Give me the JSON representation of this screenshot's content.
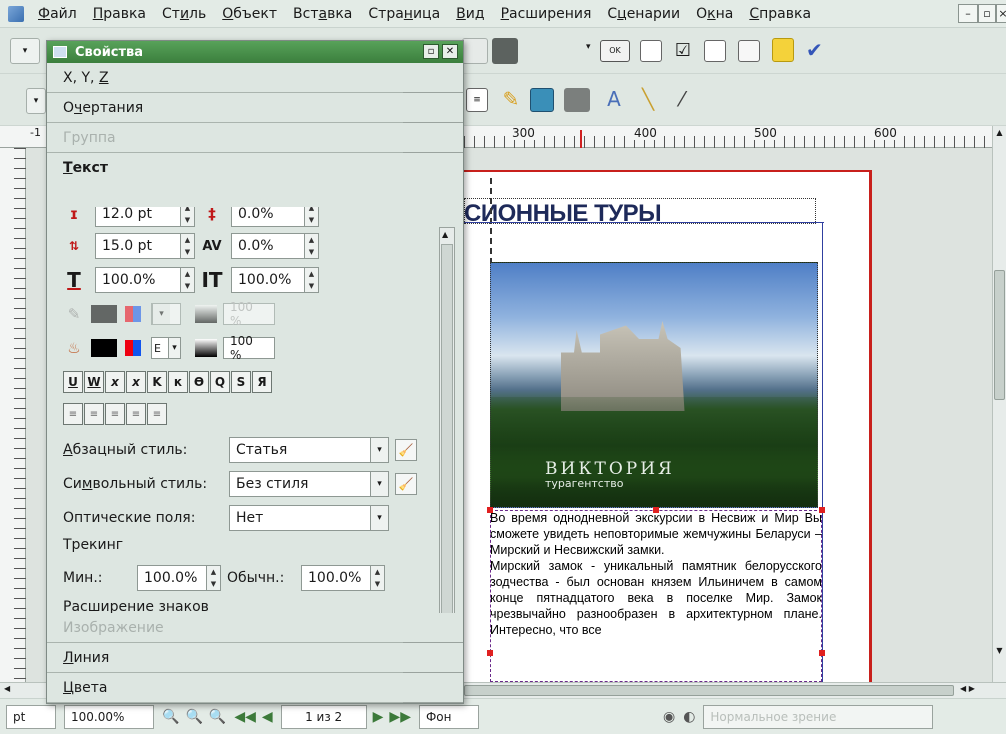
{
  "menubar": {
    "items": [
      {
        "pre": "",
        "acc": "Ф",
        "post": "айл"
      },
      {
        "pre": "",
        "acc": "П",
        "post": "равка"
      },
      {
        "pre": "Ст",
        "acc": "и",
        "post": "ль"
      },
      {
        "pre": "",
        "acc": "О",
        "post": "бъект"
      },
      {
        "pre": "Вст",
        "acc": "а",
        "post": "вка"
      },
      {
        "pre": "Стра",
        "acc": "н",
        "post": "ица"
      },
      {
        "pre": "",
        "acc": "В",
        "post": "ид"
      },
      {
        "pre": "",
        "acc": "Р",
        "post": "асширения"
      },
      {
        "pre": "С",
        "acc": "ц",
        "post": "енарии"
      },
      {
        "pre": "О",
        "acc": "к",
        "post": "на"
      },
      {
        "pre": "",
        "acc": "С",
        "post": "правка"
      }
    ],
    "window_controls": [
      "–",
      "🗗",
      "×"
    ]
  },
  "panel": {
    "title": "Свойства",
    "sections_top": [
      {
        "pre": "X, Y, ",
        "acc": "Z",
        "post": "",
        "disabled": false
      },
      {
        "pre": "О",
        "acc": "ч",
        "post": "ертания",
        "disabled": false
      },
      {
        "pre": "Группа",
        "acc": "",
        "post": "",
        "disabled": true
      }
    ],
    "text_section": {
      "pre": "",
      "acc": "Т",
      "post": "екст"
    },
    "font_size": "12.0 pt",
    "kerning": "0.0%",
    "line_spacing": "15.0 pt",
    "tracking_manual": "0.0%",
    "scale_h": "100.0%",
    "scale_v": "100.0%",
    "stroke_shade": "100 %",
    "fill_shade": "100 %",
    "fill_letter": "E",
    "format_buttons": [
      "U",
      "W",
      "x",
      "x",
      "K",
      "к",
      "Ѳ",
      "Q",
      "S",
      "Я"
    ],
    "align_buttons": [
      "≡",
      "≡",
      "≡",
      "≡",
      "≡"
    ],
    "para_style_label": {
      "pre": "",
      "acc": "А",
      "post": "бзацный стиль:"
    },
    "para_style_value": "Статья",
    "char_style_label": {
      "pre": "Си",
      "acc": "м",
      "post": "вольный стиль:"
    },
    "char_style_value": "Без стиля",
    "optical_margins_label": "Оптические поля:",
    "optical_margins_value": "Нет",
    "tracking_label": "Трекинг",
    "min_label": "Мин.:",
    "min_value": "100.0%",
    "normal_label": "Обычн.:",
    "normal_value": "100.0%",
    "glyph_extension_label": "Расширение знаков",
    "sections_bottom": [
      {
        "pre": "Изображение",
        "acc": "",
        "post": "",
        "disabled": true
      },
      {
        "pre": "",
        "acc": "Л",
        "post": "иния",
        "disabled": false
      },
      {
        "pre": "",
        "acc": "Ц",
        "post": "вета",
        "disabled": false
      }
    ]
  },
  "ruler": {
    "h_labels": [
      "300",
      "400",
      "500",
      "600"
    ],
    "left_label": "-1"
  },
  "document": {
    "heading": "СИОННЫЕ ТУРЫ",
    "image_caption_big": "ВИКТОРИЯ",
    "image_caption_small": "турагентство",
    "paragraph1": "Во время однодневной экскурсии в Несвиж и Мир Вы сможете увидеть неповторимые жемчужины Беларуси – Мирский и Несвижский замки.",
    "paragraph2": "Мирский замок - уникальный памятник белорусского зодчества - был основан князем Ильиничем в самом конце пятнадцатого века в поселке Мир. Замок чрезвычайно разнообразен в архитектурном плане. Интересно, что все"
  },
  "statusbar": {
    "unit": "pt",
    "zoom": "100.00%",
    "page": "1 из 2",
    "layer": "Фон",
    "view_mode": "Нормальное зрение"
  },
  "colors": {
    "accent_green": "#4a944c",
    "page_border": "#c8201c"
  }
}
